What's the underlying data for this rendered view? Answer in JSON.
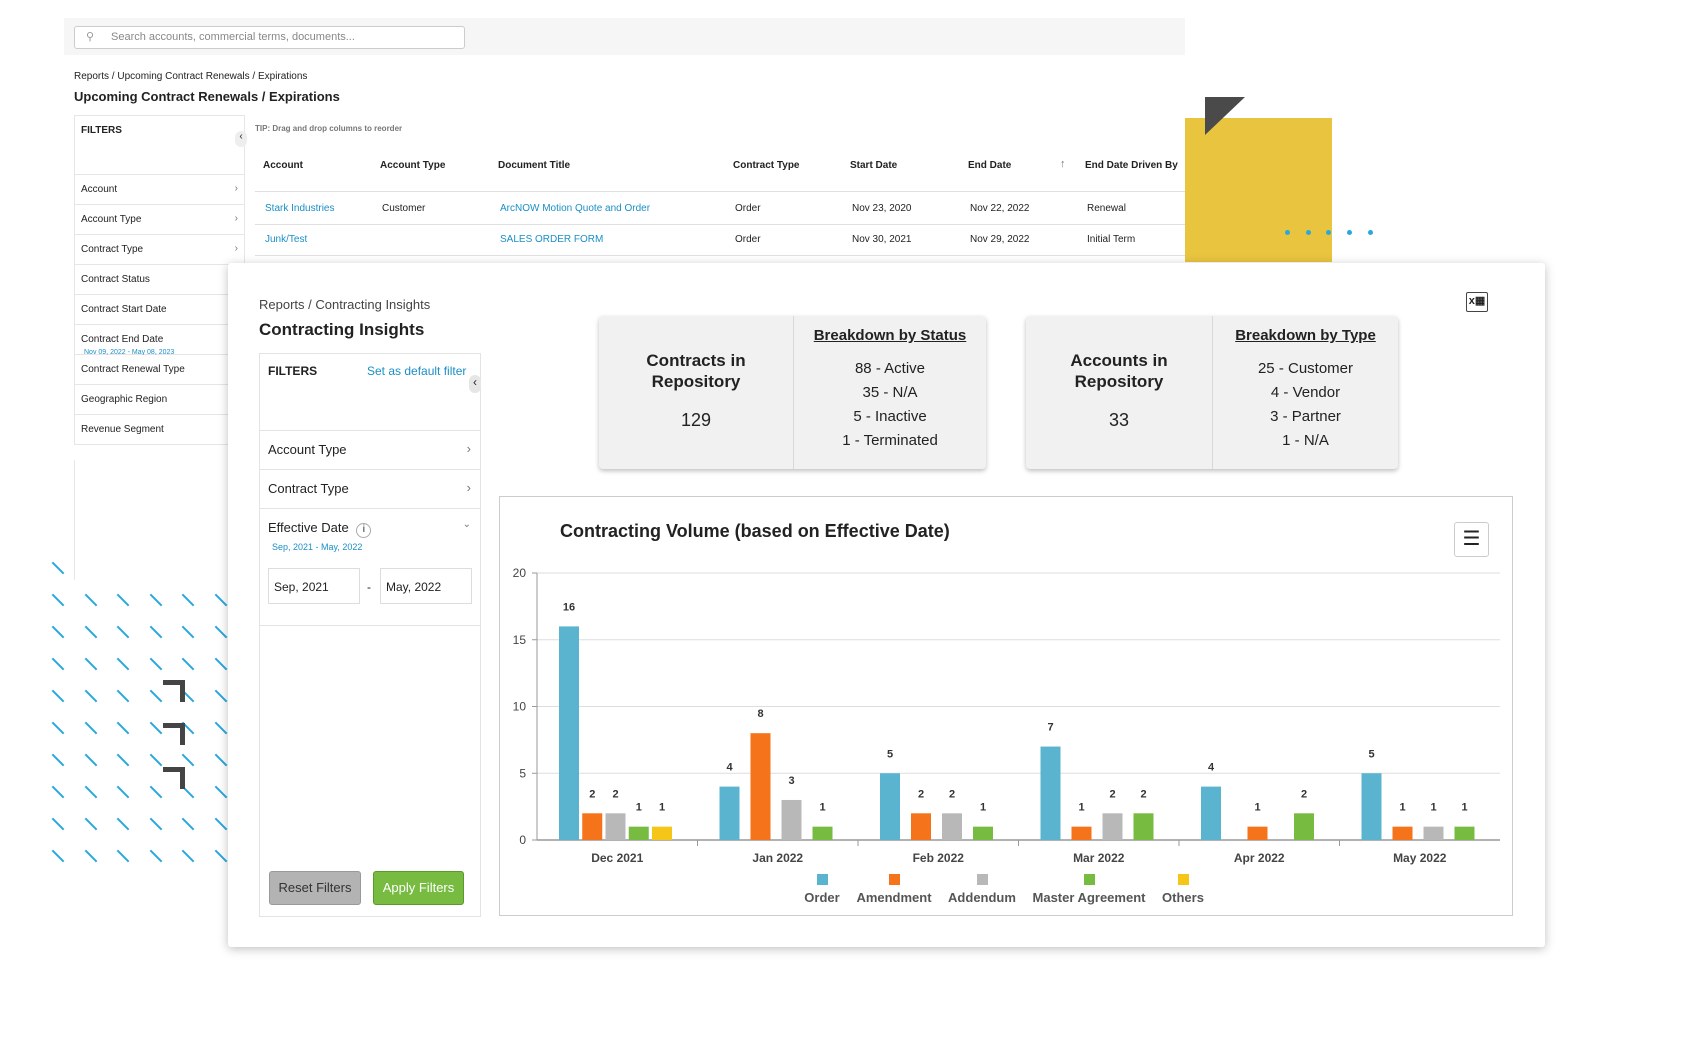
{
  "back": {
    "search_placeholder": "Search accounts, commercial terms, documents...",
    "breadcrumb": "Reports / Upcoming Contract Renewals / Expirations",
    "title": "Upcoming Contract Renewals / Expirations",
    "filters_label": "FILTERS",
    "filters": [
      {
        "label": "Account",
        "chevron": true
      },
      {
        "label": "Account Type",
        "chevron": true
      },
      {
        "label": "Contract Type",
        "chevron": true
      },
      {
        "label": "Contract Status"
      },
      {
        "label": "Contract Start Date"
      },
      {
        "label": "Contract End Date",
        "sub": "Nov 09, 2022 - May 08, 2023"
      },
      {
        "label": "Contract Renewal Type"
      },
      {
        "label": "Geographic Region"
      },
      {
        "label": "Revenue Segment"
      }
    ],
    "tip": "TIP: Drag and drop columns to reorder",
    "columns": [
      "Account",
      "Account Type",
      "Document Title",
      "Contract Type",
      "Start Date",
      "End Date",
      "End Date Driven By"
    ],
    "rows": [
      [
        "Stark Industries",
        "Customer",
        "ArcNOW Motion Quote and Order",
        "Order",
        "Nov 23, 2020",
        "Nov 22, 2022",
        "Renewal"
      ],
      [
        "Junk/Test",
        "",
        "SALES ORDER FORM",
        "Order",
        "Nov 30, 2021",
        "Nov 29, 2022",
        "Initial Term"
      ]
    ]
  },
  "front": {
    "breadcrumb": "Reports / Contracting Insights",
    "title": "Contracting Insights",
    "filters_label": "FILTERS",
    "set_default": "Set as default filter",
    "account_type": "Account Type",
    "contract_type": "Contract Type",
    "effective_date": "Effective Date",
    "effective_range": "Sep, 2021 - May, 2022",
    "from": "Sep, 2021",
    "to": "May, 2022",
    "sep": "-",
    "reset": "Reset Filters",
    "apply": "Apply Filters",
    "stats1": {
      "label": "Contracts in Repository",
      "value": "129",
      "heading": "Breakdown by Status",
      "items": [
        "88 - Active",
        "35 - N/A",
        "5 - Inactive",
        "1 - Terminated"
      ]
    },
    "stats2": {
      "label": "Accounts in Repository",
      "value": "33",
      "heading": "Breakdown by Type",
      "items": [
        "25 - Customer",
        "4 - Vendor",
        "3 - Partner",
        "1 - N/A"
      ]
    }
  },
  "colors": {
    "accent": "#1a8fc6",
    "apply": "#77bb41",
    "reset": "#b3b3b3",
    "yellow": "#e8c43f"
  },
  "chart_data": {
    "type": "bar",
    "title": "Contracting Volume (based on Effective Date)",
    "categories": [
      "Dec 2021",
      "Jan 2022",
      "Feb 2022",
      "Mar 2022",
      "Apr 2022",
      "May 2022"
    ],
    "ylim": [
      0,
      20
    ],
    "yticks": [
      "0",
      "5",
      "10",
      "15",
      "20"
    ],
    "grid": true,
    "legend": "bottom",
    "series": [
      {
        "name": "Order",
        "color": "#5ab4d0",
        "values": [
          16,
          4,
          5,
          7,
          4,
          5
        ]
      },
      {
        "name": "Amendment",
        "color": "#f5731a",
        "values": [
          2,
          8,
          2,
          1,
          1,
          1
        ]
      },
      {
        "name": "Addendum",
        "color": "#b8b8b8",
        "values": [
          2,
          3,
          2,
          2,
          0,
          1
        ]
      },
      {
        "name": "Master Agreement",
        "color": "#77bb41",
        "values": [
          1,
          1,
          1,
          2,
          2,
          1
        ]
      },
      {
        "name": "Others",
        "color": "#f5c518",
        "values": [
          1,
          0,
          0,
          0,
          0,
          0
        ]
      }
    ]
  }
}
